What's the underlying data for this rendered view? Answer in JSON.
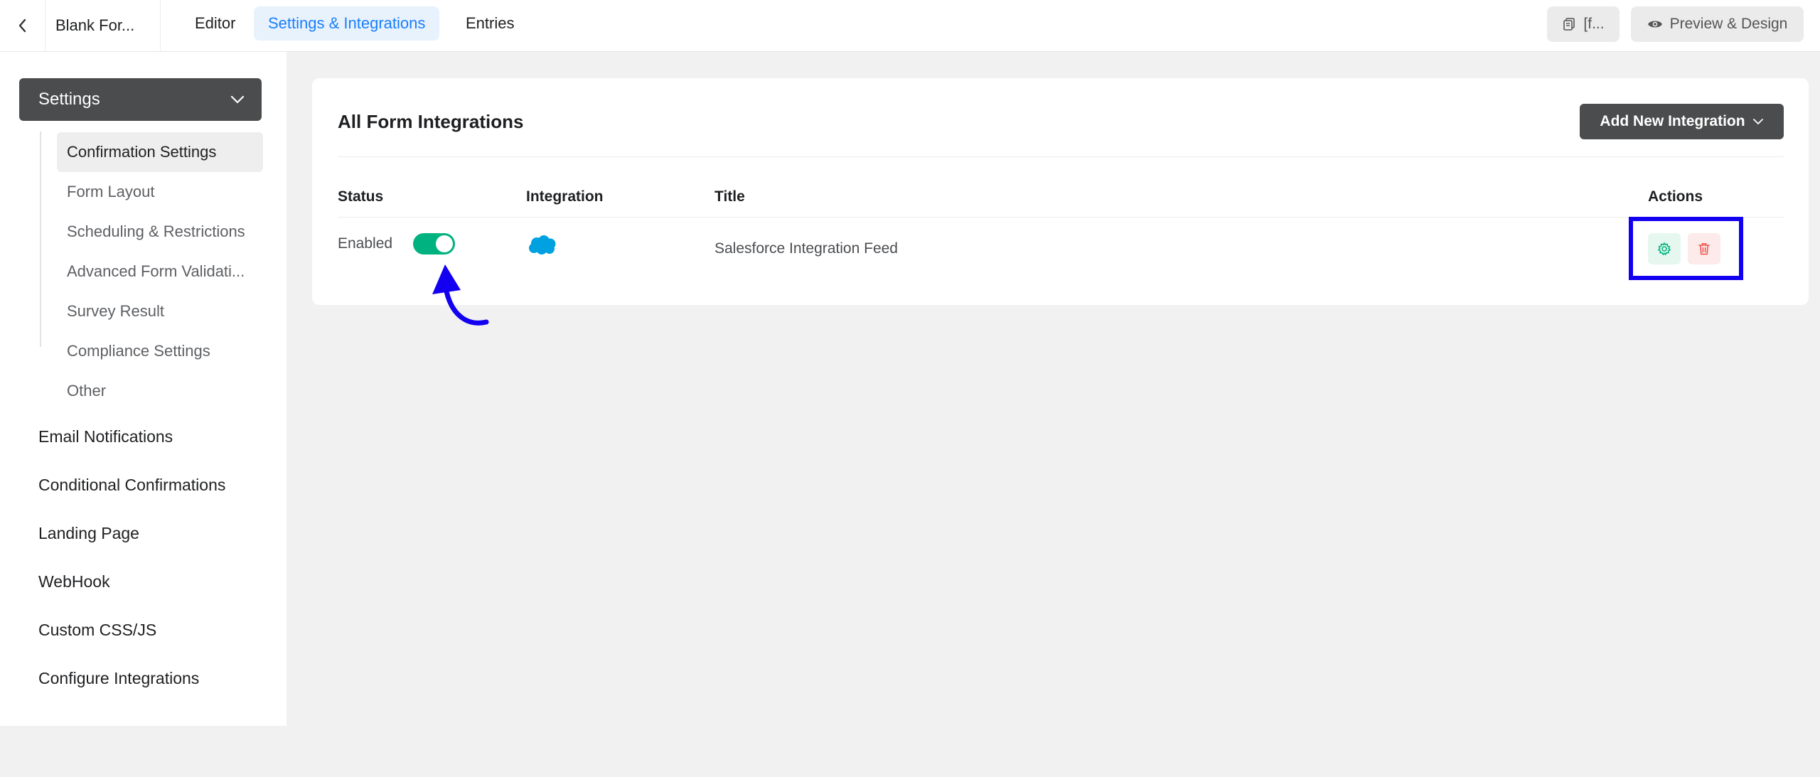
{
  "header": {
    "form_name": "Blank For...",
    "tabs": [
      {
        "label": "Editor"
      },
      {
        "label": "Settings & Integrations"
      },
      {
        "label": "Entries"
      }
    ],
    "shortcode_label": "[f...",
    "preview_label": "Preview & Design"
  },
  "sidebar": {
    "settings_label": "Settings",
    "sub_items": [
      {
        "label": "Confirmation Settings"
      },
      {
        "label": "Form Layout"
      },
      {
        "label": "Scheduling & Restrictions"
      },
      {
        "label": "Advanced Form Validati..."
      },
      {
        "label": "Survey Result"
      },
      {
        "label": "Compliance Settings"
      },
      {
        "label": "Other"
      }
    ],
    "items": [
      {
        "label": "Email Notifications"
      },
      {
        "label": "Conditional Confirmations"
      },
      {
        "label": "Landing Page"
      },
      {
        "label": "WebHook"
      },
      {
        "label": "Custom CSS/JS"
      },
      {
        "label": "Configure Integrations"
      }
    ]
  },
  "main": {
    "title": "All Form Integrations",
    "add_button_label": "Add New Integration",
    "table": {
      "headers": {
        "status": "Status",
        "integration": "Integration",
        "title": "Title",
        "actions": "Actions"
      },
      "rows": [
        {
          "status": "Enabled",
          "integration_icon": "salesforce-cloud-icon",
          "title": "Salesforce Integration Feed",
          "enabled": true
        }
      ]
    }
  },
  "colors": {
    "accent": "#1a7efb",
    "toggle_on": "#00b27f",
    "dark_button": "#4b4c4d",
    "annotation": "#1300f0",
    "salesforce": "#00a1e0"
  }
}
